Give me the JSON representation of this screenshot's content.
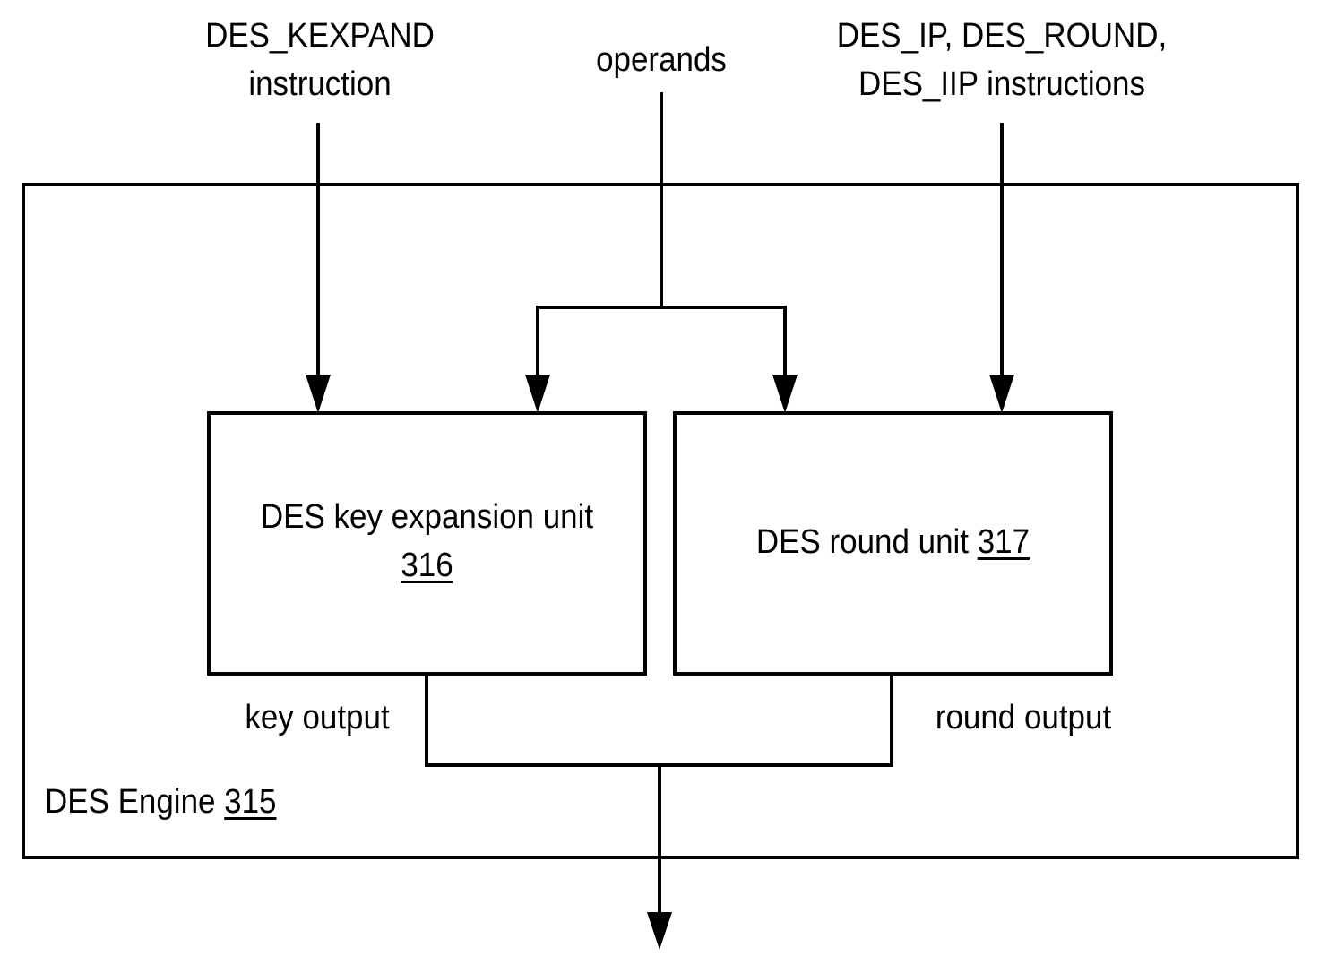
{
  "diagram": {
    "inputs": {
      "kexpand": {
        "line1": "DES_KEXPAND",
        "line2": "instruction"
      },
      "operands": {
        "label": "operands"
      },
      "round_instr": {
        "line1": "DES_IP, DES_ROUND,",
        "line2": "DES_IIP instructions"
      }
    },
    "engine": {
      "label": "DES Engine ",
      "ref": "315"
    },
    "key_unit": {
      "label": "DES key expansion unit",
      "ref": "316"
    },
    "round_unit": {
      "label": "DES round unit ",
      "ref": "317"
    },
    "outputs": {
      "key": "key output",
      "round": "round output"
    }
  }
}
